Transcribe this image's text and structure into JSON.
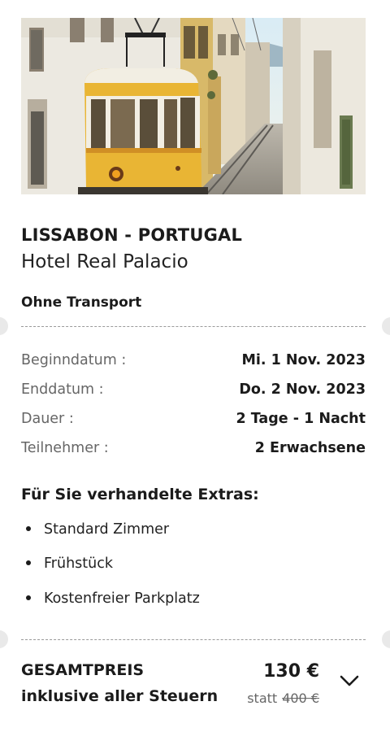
{
  "offer": {
    "location": "LISSABON - PORTUGAL",
    "hotel": "Hotel Real Palacio",
    "transport": "Ohne Transport"
  },
  "details": [
    {
      "label": "Beginndatum :",
      "value": "Mi. 1 Nov. 2023"
    },
    {
      "label": "Enddatum :",
      "value": "Do. 2 Nov. 2023"
    },
    {
      "label": "Dauer :",
      "value": "2 Tage - 1 Nacht"
    },
    {
      "label": "Teilnehmer :",
      "value": "2 Erwachsene"
    }
  ],
  "extras": {
    "title": "Für Sie verhandelte Extras:",
    "items": [
      "Standard Zimmer",
      "Frühstück",
      "Kostenfreier Parkplatz"
    ]
  },
  "total": {
    "label_line1": "GESAMTPREIS",
    "label_line2": "inklusive aller Steuern",
    "price": "130 €",
    "statt_label": "statt",
    "old_price": "400 €"
  },
  "icons": {
    "expand": "chevron-down-icon",
    "hero": "tram-photo"
  },
  "colors": {
    "tram_yellow": "#e9b534",
    "text": "#1b1b1b",
    "muted": "#666666",
    "divider": "#9a9a9a"
  }
}
